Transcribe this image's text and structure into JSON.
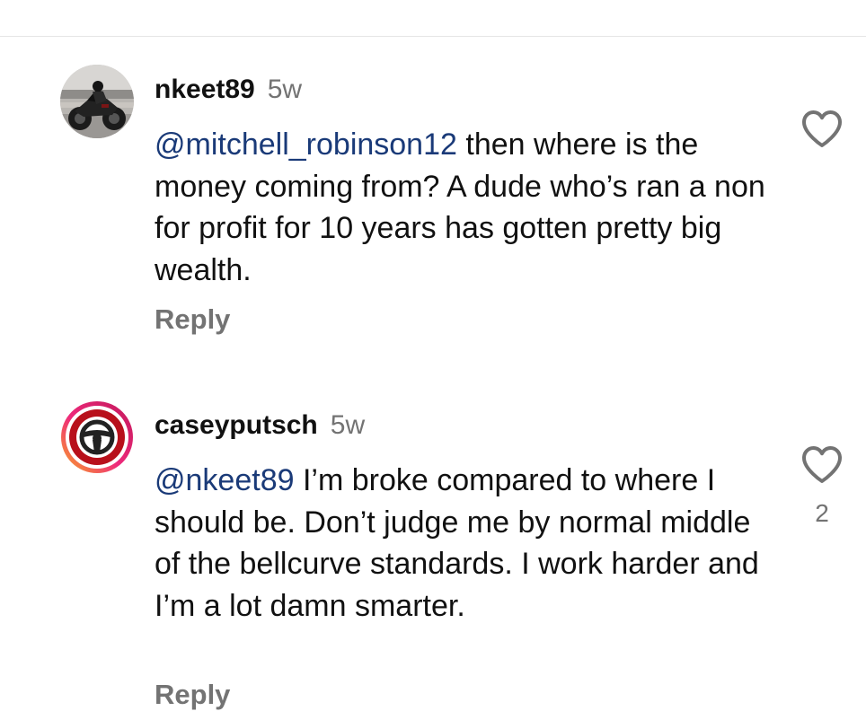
{
  "comments": [
    {
      "username": "nkeet89",
      "time": "5w",
      "mention": "@mitchell_robinson12",
      "text": " then where is the money coming from? A dude who’s ran a non for profit for 10 years has gotten pretty big wealth.",
      "reply_label": "Reply",
      "like_icon": "heart-outline-icon",
      "like_count": "",
      "avatar_icon": "motorcycle-rider-photo"
    },
    {
      "username": "caseyputsch",
      "time": "5w",
      "mention": "@nkeet89",
      "text": " I’m broke compared to where I should be. Don’t judge me by normal middle of the bellcurve standards. I work harder and I’m a lot damn smarter.",
      "reply_label": "Reply",
      "like_icon": "heart-outline-icon",
      "like_count": "2",
      "avatar_icon": "steering-wheel-icon",
      "story_ring": true
    }
  ],
  "colors": {
    "text": "#111111",
    "secondary": "#737373",
    "mention": "#1a3a78",
    "divider": "#e6e6e6"
  }
}
